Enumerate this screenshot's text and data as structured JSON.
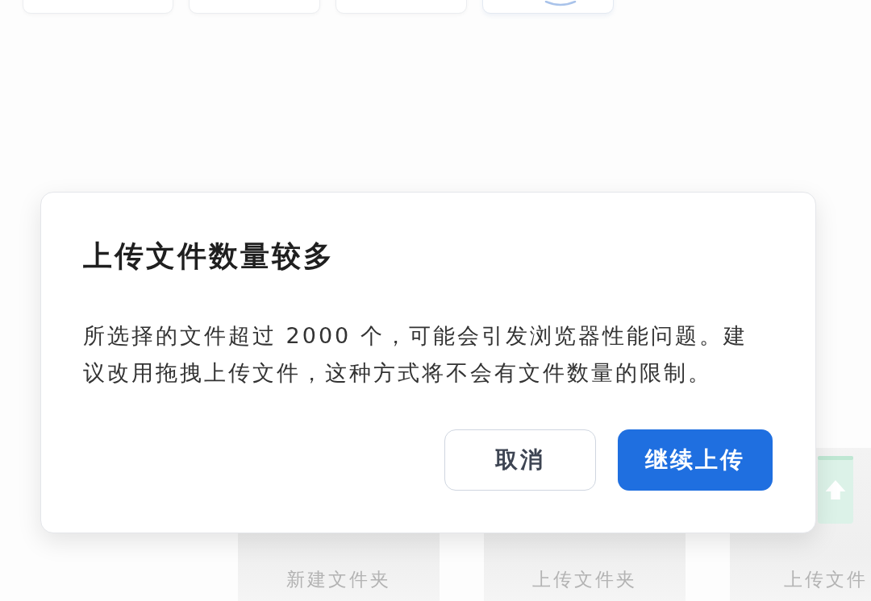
{
  "toolbar": [
    {
      "kind": "plain"
    },
    {
      "kind": "plain"
    },
    {
      "kind": "plain"
    },
    {
      "kind": "accent"
    }
  ],
  "cards": [
    {
      "kind": "new_folder",
      "label": "新建文件夹"
    },
    {
      "kind": "upload_folder",
      "label": "上传文件夹"
    },
    {
      "kind": "upload_file",
      "label": "上传文件"
    }
  ],
  "dialog": {
    "title": "上传文件数量较多",
    "message": "所选择的文件超过 2000 个，可能会引发浏览器性能问题。建议改用拖拽上传文件，这种方式将不会有文件数量的限制。",
    "buttons": [
      {
        "kind": "secondary",
        "label": "取消"
      },
      {
        "kind": "primary",
        "label": "继续上传"
      }
    ]
  }
}
